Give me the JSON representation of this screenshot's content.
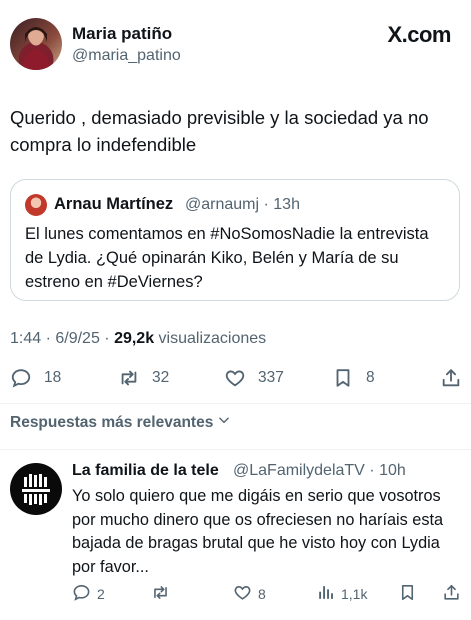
{
  "header": {
    "author_name": "Maria patiño",
    "author_handle": "@maria_patino",
    "site_label": "X.com"
  },
  "tweet": {
    "text": "Querido , demasiado previsible y la sociedad ya no compra lo indefendible"
  },
  "quote": {
    "author_name": "Arnau Martínez",
    "author_handle": "@arnaumj · 13h",
    "text": "El lunes comentamos en #NoSomosNadie la entrevista de Lydia. ¿Qué opinarán Kiko, Belén y María de su estreno en #DeViernes?"
  },
  "meta": {
    "datetime": "1:44 · 6/9/25 · ",
    "views_count": "29,2k",
    "views_label": " visualizaciones"
  },
  "actions": {
    "replies": "18",
    "retweets": "32",
    "likes": "337",
    "bookmarks": "8"
  },
  "relevant_label": "Respuestas más relevantes",
  "reply": {
    "author_name": "La familia de la tele",
    "author_handle": "@LaFamilydelaTV · 10h",
    "text": "Yo solo quiero que me digáis en serio que vosotros por mucho dinero que os ofreciesen no haríais esta bajada de bragas brutal que he visto hoy con Lydia por favor...",
    "replies": "2",
    "retweets": "",
    "likes": "8",
    "views": "1,1k"
  },
  "icons": {
    "reply": "reply-icon",
    "retweet": "retweet-icon",
    "like": "heart-icon",
    "bookmark": "bookmark-icon",
    "share": "share-icon",
    "views": "views-icon",
    "chevron": "chevron-down-icon"
  }
}
